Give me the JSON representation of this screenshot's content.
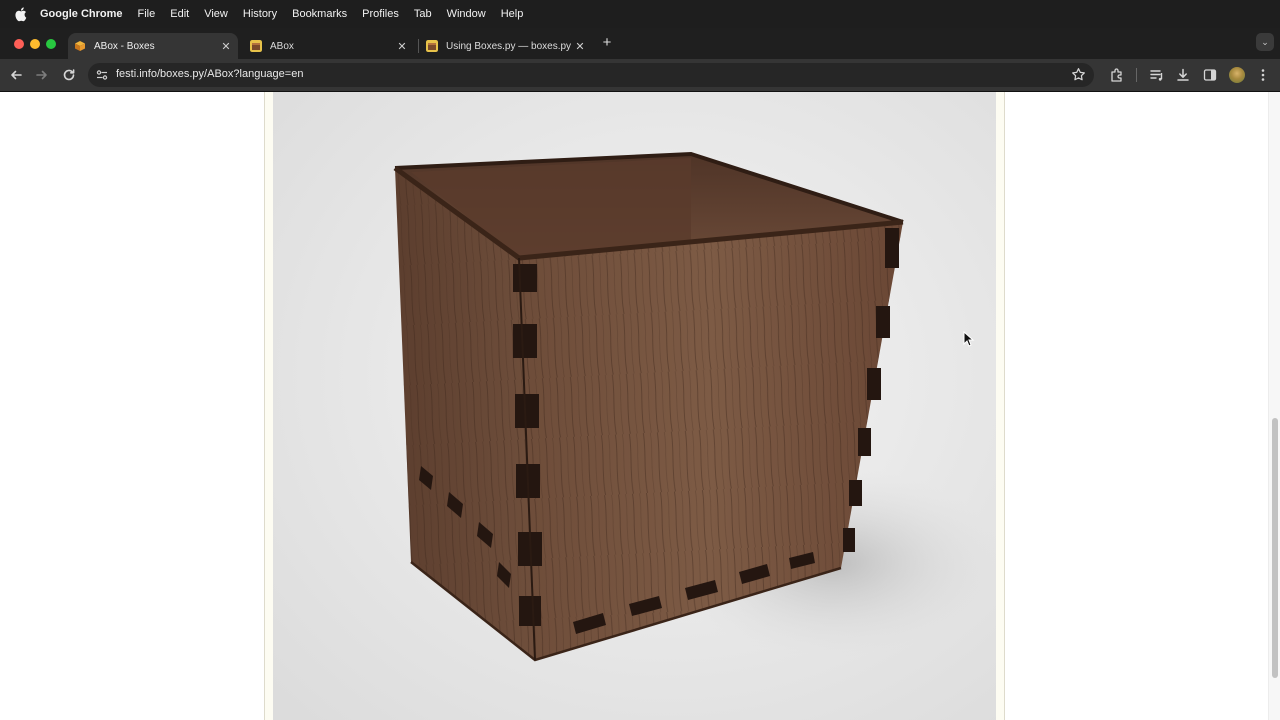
{
  "menubar": {
    "app_name": "Google Chrome",
    "items": [
      "File",
      "Edit",
      "View",
      "History",
      "Bookmarks",
      "Profiles",
      "Tab",
      "Window",
      "Help"
    ]
  },
  "tabs": [
    {
      "title": "ABox - Boxes",
      "active": true
    },
    {
      "title": "ABox",
      "active": false
    },
    {
      "title": "Using Boxes.py — boxes.py d",
      "active": false
    }
  ],
  "toolbar": {
    "url_host": "festi.info",
    "url_path": "/boxes.py/ABox?language=en"
  },
  "page": {
    "image_subject": "wooden finger-jointed open box (walnut veneer)"
  },
  "colors": {
    "chrome_dark": "#1f1f1f",
    "toolbar": "#353535",
    "content_bg": "#fdfcf2",
    "wood_light": "#7a5a44",
    "wood_dark": "#4a3022"
  },
  "icons": [
    "apple-icon",
    "back-icon",
    "forward-icon",
    "reload-icon",
    "site-info-icon",
    "bookmark-star-icon",
    "extensions-icon",
    "media-control-icon",
    "download-icon",
    "side-panel-icon",
    "profile-avatar",
    "menu-kebab-icon"
  ]
}
